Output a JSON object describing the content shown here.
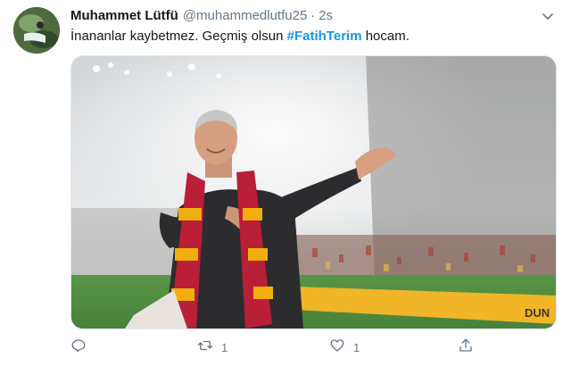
{
  "tweet": {
    "display_name": "Muhammet Lütfü",
    "handle": "@muhammedlutfu25",
    "separator": "·",
    "time": "2s",
    "text_before": "İnananlar kaybetmez. Geçmiş olsun ",
    "hashtag": "#FatihTerim",
    "text_after": " hocam.",
    "media_ad_text": "DUN"
  },
  "actions": {
    "reply_count": "",
    "retweet_count": "1",
    "like_count": "1",
    "share_count": ""
  },
  "colors": {
    "hashtag": "#1b95e0",
    "muted": "#657786",
    "text": "#14171a",
    "scarf_red": "#b5122b",
    "scarf_yellow": "#f2a900"
  },
  "icons": {
    "reply": "reply-icon",
    "retweet": "retweet-icon",
    "like": "heart-icon",
    "share": "share-icon",
    "menu": "chevron-down-icon"
  }
}
